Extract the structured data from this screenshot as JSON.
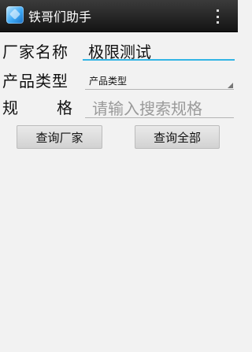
{
  "app": {
    "title": "铁哥们助手",
    "icon": "app-icon",
    "menu_icon": "overflow-menu-icon"
  },
  "form": {
    "manufacturer": {
      "label": "厂家名称",
      "value": "极限测试"
    },
    "product_type": {
      "label": "产品类型",
      "selected": "产品类型"
    },
    "spec": {
      "label_1": "规",
      "label_2": "格",
      "placeholder": "请输入搜索规格"
    }
  },
  "buttons": {
    "query_manufacturer": "查询厂家",
    "query_all": "查询全部"
  },
  "colors": {
    "accent": "#33b5e5",
    "action_bar": "#1e1e1e",
    "background": "#f2f2f2"
  }
}
